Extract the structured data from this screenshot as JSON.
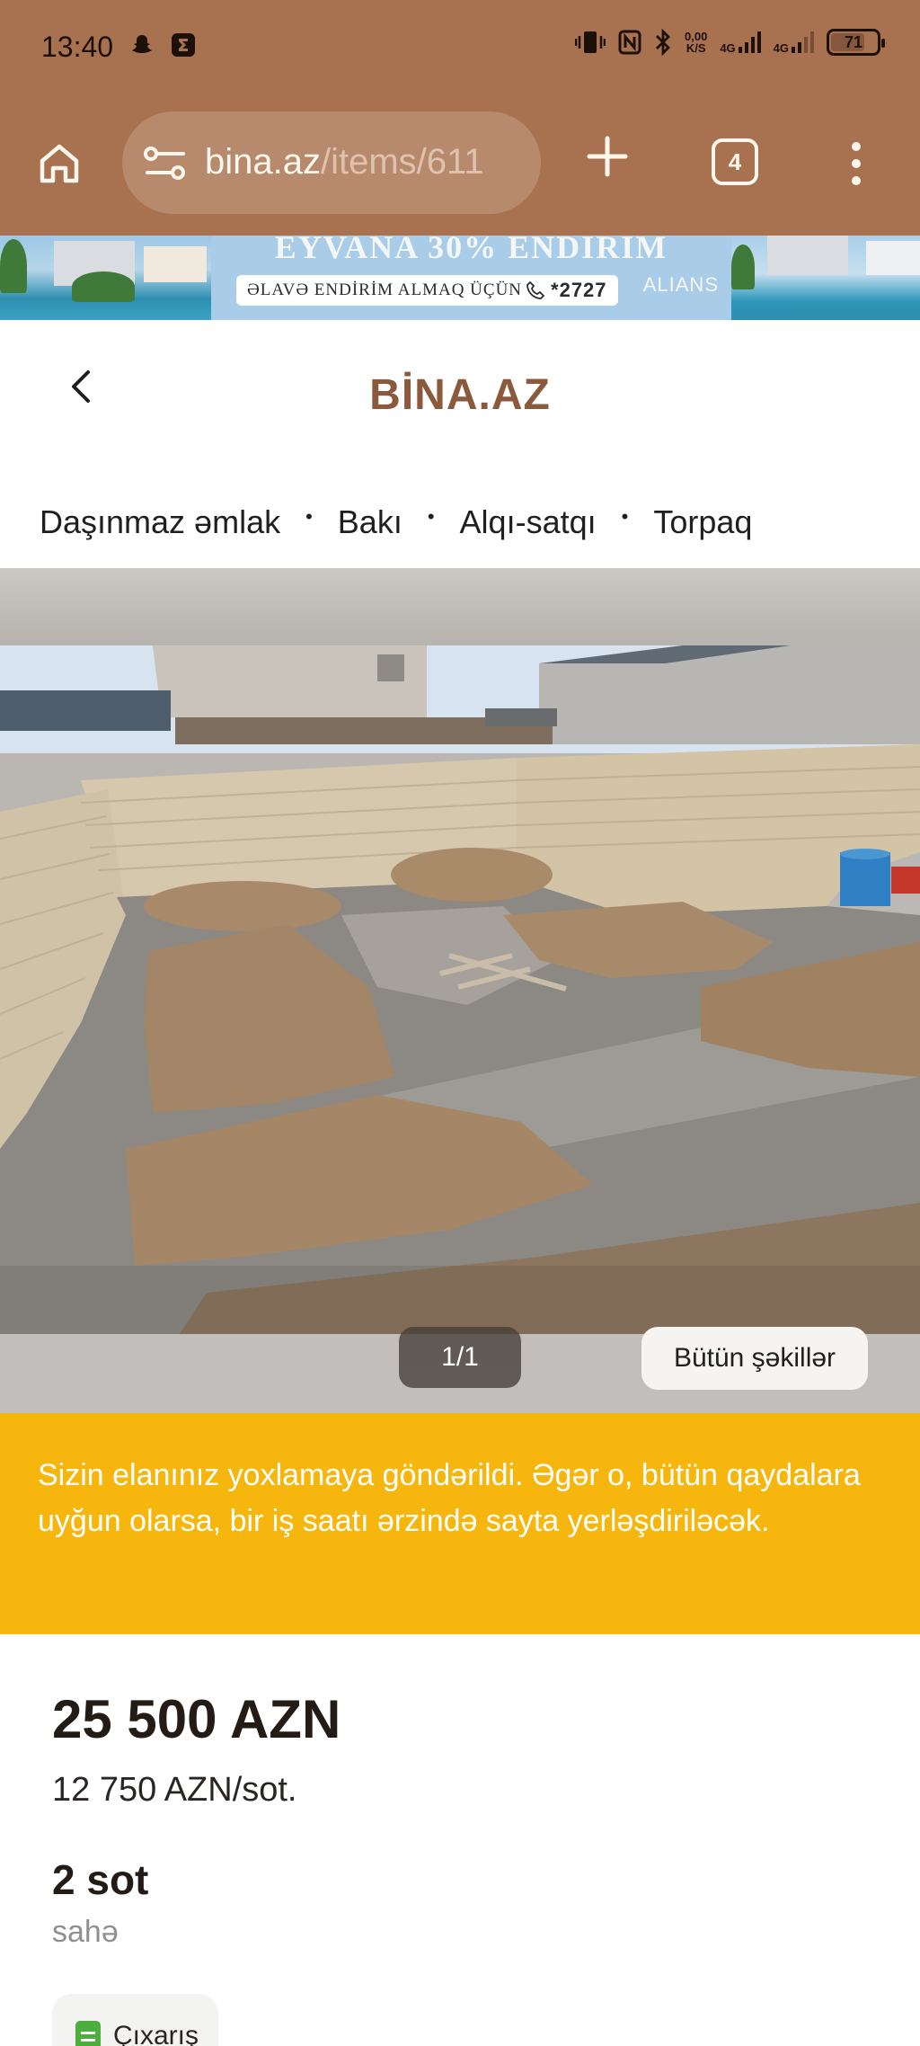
{
  "colors": {
    "chrome": "#a8714f",
    "brand": "#8b5a3c",
    "notice_bg": "#f7b60d"
  },
  "status_bar": {
    "time": "13:40",
    "net_speed_value": "0,00",
    "net_speed_unit": "K/S",
    "sim1": "4G",
    "sim2": "4G",
    "battery": "71",
    "icons": [
      "snapchat-icon",
      "e-app-icon",
      "vibrate-icon",
      "nfc-icon",
      "bluetooth-icon",
      "signal-icon",
      "battery-icon"
    ]
  },
  "browser": {
    "url_host": "bina.az",
    "url_path": "/items/611",
    "tab_count": "4"
  },
  "ad_banner": {
    "headline": "EYVANA 30% ENDİRİM",
    "pill_text": "ƏLAVƏ ENDİRİM ALMAQ ÜÇÜN",
    "phone": "*2727",
    "brand": "ALIANS"
  },
  "site": {
    "logo": "BİNA.AZ",
    "breadcrumbs": [
      "Daşınmaz əmlak",
      "Bakı",
      "Alqı-satqı",
      "Torpaq"
    ]
  },
  "gallery": {
    "counter": "1/1",
    "all_photos_label": "Bütün şəkillər"
  },
  "notice": {
    "text": "Sizin elanınız yoxlamaya göndərildi. Əgər o, bütün qaydalara uyğun olarsa, bir iş saatı ərzində sayta yerləşdiriləcək."
  },
  "listing": {
    "price": "25 500 AZN",
    "price_per_unit": "12 750 AZN/sot.",
    "area": "2 sot",
    "area_label": "sahə",
    "document_badge": "Çıxarış"
  }
}
